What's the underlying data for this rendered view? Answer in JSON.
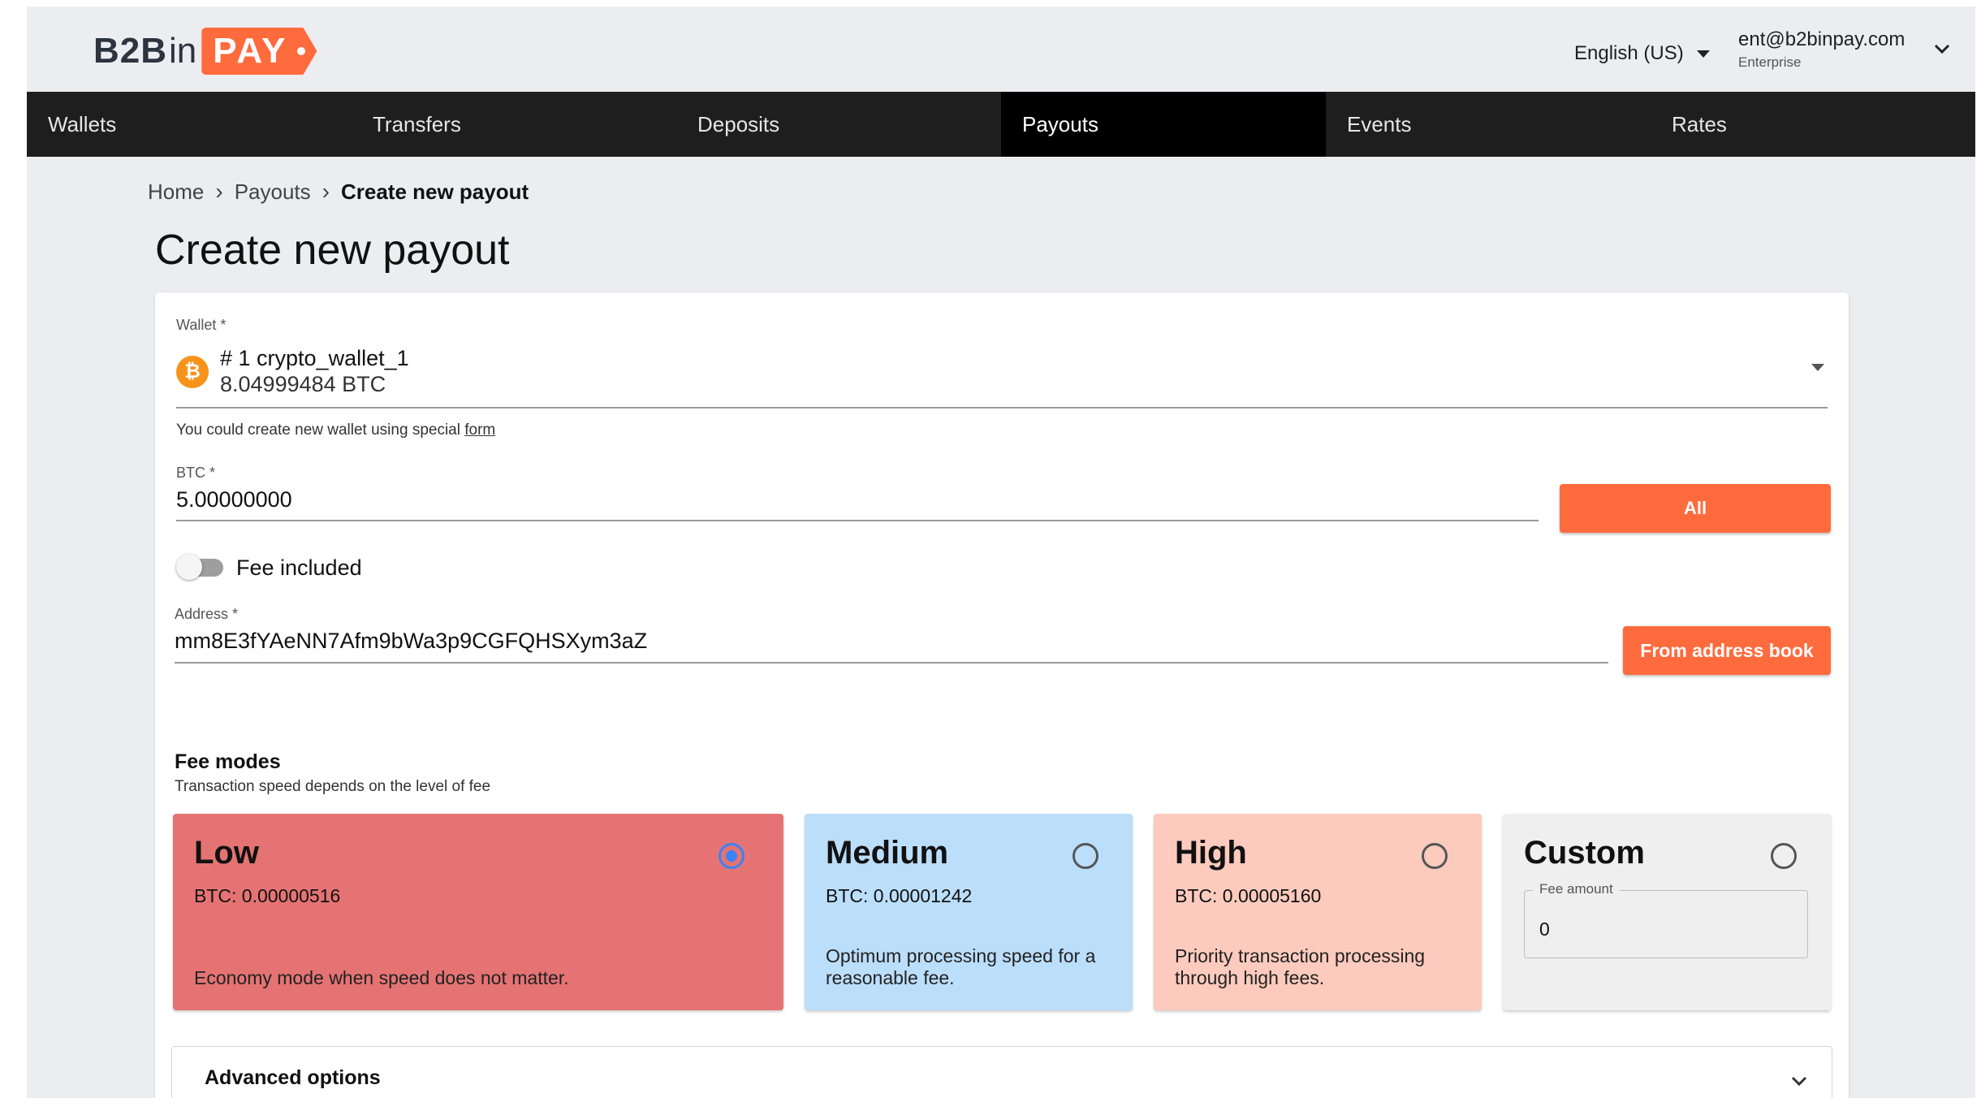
{
  "brand": {
    "logo_b2b": "B2B",
    "logo_in": "in",
    "logo_pay": "PAY"
  },
  "header": {
    "language": "English (US)",
    "user_email": "ent@b2binpay.com",
    "user_role": "Enterprise"
  },
  "nav": {
    "items": [
      "Wallets",
      "Transfers",
      "Deposits",
      "Payouts",
      "Events",
      "Rates"
    ],
    "active": "Payouts"
  },
  "breadcrumb": {
    "home": "Home",
    "section": "Payouts",
    "current": "Create new payout"
  },
  "page": {
    "title": "Create new payout"
  },
  "form": {
    "wallet_label": "Wallet *",
    "wallet_name": "# 1 crypto_wallet_1",
    "wallet_balance": "8.04999484 BTC",
    "wallet_hint": "You could create new wallet using special",
    "wallet_hint_link": "form",
    "amount_label": "BTC *",
    "amount_value": "5.00000000",
    "all_button": "All",
    "fee_included_label": "Fee included",
    "fee_included": false,
    "address_label": "Address *",
    "address_value": "mm8E3fYAeNN7Afm9bWa3p9CGFQHSXym3aZ",
    "address_book_button": "From address book"
  },
  "fee_modes": {
    "title": "Fee modes",
    "subtitle": "Transaction speed depends on the level of fee",
    "selected": "Low",
    "low": {
      "name": "Low",
      "fee": "BTC: 0.00000516",
      "description": "Economy mode when speed does not matter.",
      "color": "#e57373"
    },
    "medium": {
      "name": "Medium",
      "fee": "BTC: 0.00001242",
      "description_line1": "Optimum processing speed for a",
      "description_line2": "reasonable fee.",
      "color": "#bbdefb"
    },
    "high": {
      "name": "High",
      "fee": "BTC: 0.00005160",
      "description_line1": "Priority transaction processing",
      "description_line2": "through high fees.",
      "color": "#fccbbd"
    },
    "custom": {
      "name": "Custom",
      "fee_amount_label": "Fee amount",
      "fee_amount_value": "0",
      "color": "#efefef"
    }
  },
  "advanced": {
    "label": "Advanced options"
  },
  "colors": {
    "accent": "#ff6b3d",
    "nav_bg": "#1e1e1e",
    "radio_selected": "#3b82f6"
  },
  "icons": [
    "bitcoin-icon",
    "chevron-down-icon",
    "caret-down-icon"
  ]
}
